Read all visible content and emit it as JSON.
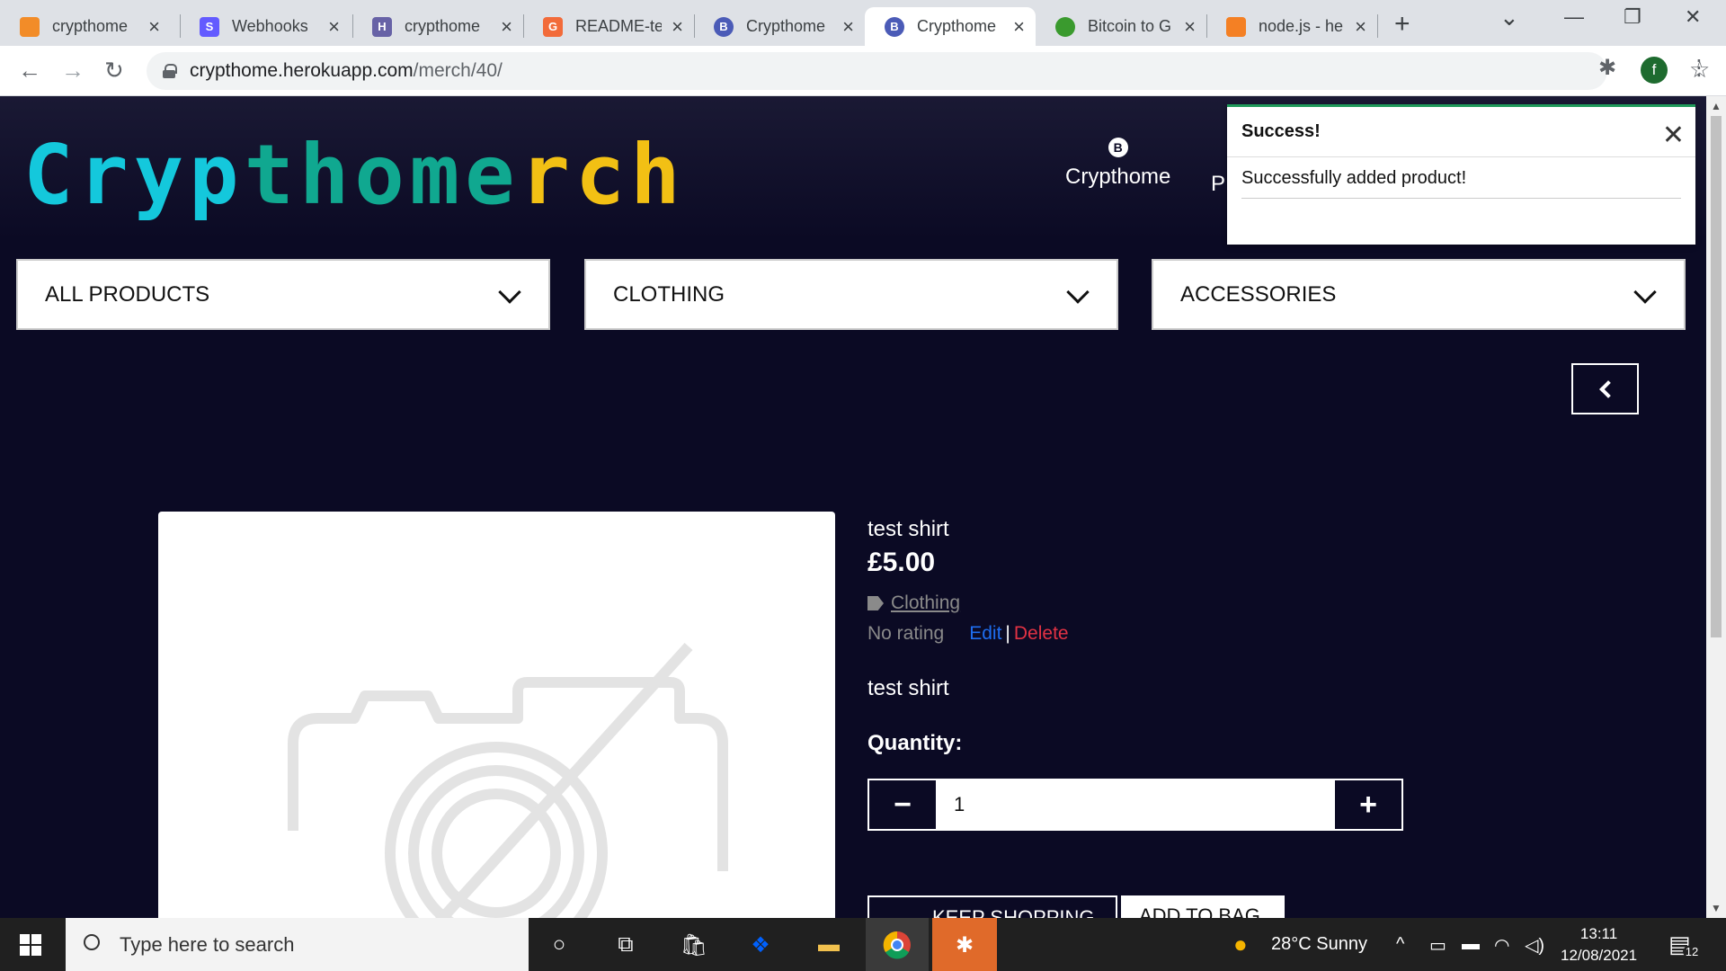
{
  "tabs": [
    {
      "title": "crypthome",
      "favicon_color": "#f28c28"
    },
    {
      "title": "Webhooks",
      "favicon_color": "#635bff",
      "favicon_letter": "S"
    },
    {
      "title": "crypthome",
      "favicon_color": "#6762a6",
      "favicon_letter": "H"
    },
    {
      "title": "README-te",
      "favicon_color": "#f26b3a",
      "favicon_letter": "G"
    },
    {
      "title": "Crypthome",
      "favicon_color": "#4b5bb7",
      "favicon_letter": "B"
    },
    {
      "title": "Crypthome",
      "favicon_color": "#4b5bb7",
      "favicon_letter": "B",
      "active": true
    },
    {
      "title": "Bitcoin to G",
      "favicon_color": "#3a9a2e"
    },
    {
      "title": "node.js - he",
      "favicon_color": "#f48024"
    }
  ],
  "address": {
    "host": "crypthome.herokuapp.com",
    "path": "/merch/40/"
  },
  "profile_letter": "f",
  "site": {
    "logo_parts": [
      "Cryp",
      "thome",
      "rch"
    ],
    "logo_middle": "me",
    "nav_crypthome": "Crypthome",
    "nav_coin": "B",
    "nav_partial": "P"
  },
  "categories": [
    "ALL PRODUCTS",
    "CLOTHING",
    "ACCESSORIES"
  ],
  "product": {
    "name": "test shirt",
    "price": "£5.00",
    "category": "Clothing",
    "rating": "No rating",
    "edit": "Edit",
    "separator": "|",
    "delete": "Delete",
    "description": "test shirt",
    "quantity_label": "Quantity:",
    "quantity": "1",
    "keep_shopping": "KEEP SHOPPING",
    "add_to_bag": "ADD TO BAG"
  },
  "toast": {
    "title": "Success!",
    "message": "Successfully added product!"
  },
  "taskbar": {
    "search_placeholder": "Type here to search",
    "weather": "28°C  Sunny",
    "time": "13:11",
    "date": "12/08/2021",
    "notifications": "12"
  }
}
